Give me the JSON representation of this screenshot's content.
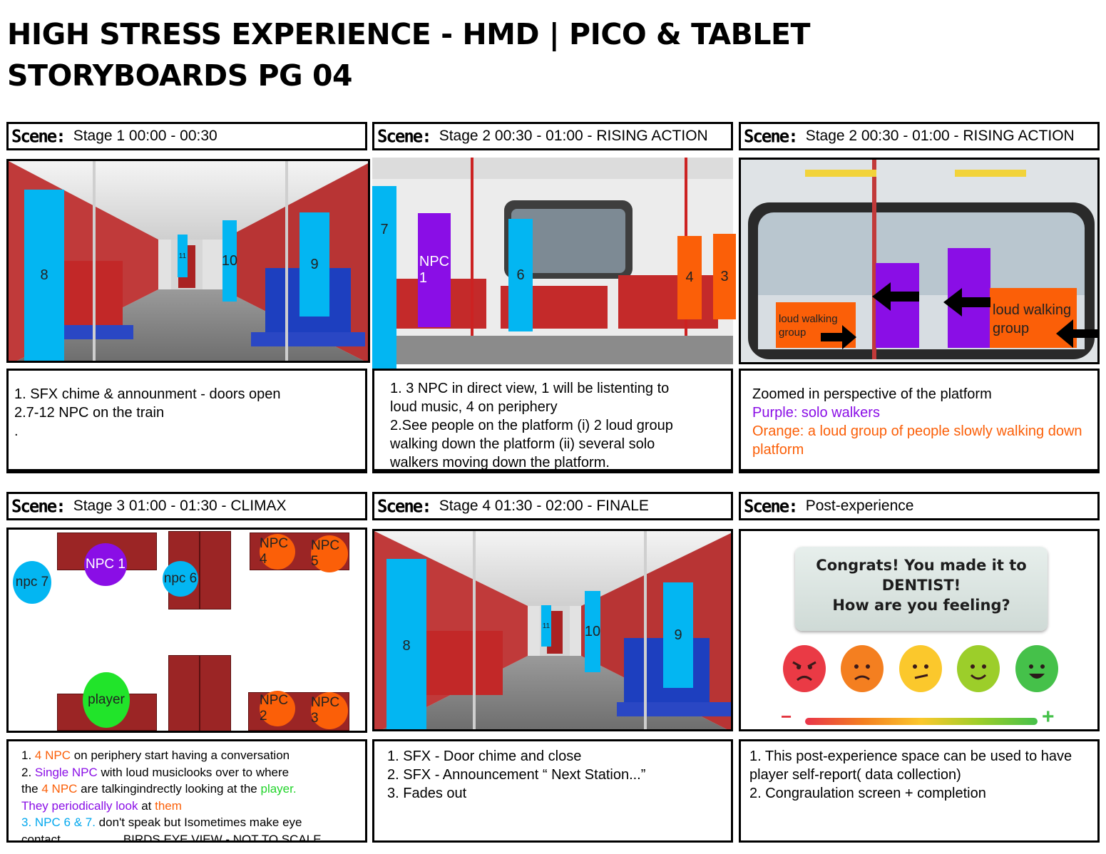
{
  "title": {
    "line1": "HIGH STRESS EXPERIENCE -  HMD | PICO & TABLET",
    "line2": "STORYBOARDS  PG 04"
  },
  "scene_label": "Scene:",
  "scenes": [
    {
      "header": "Stage 1  00:00 - 00:30",
      "blocks": {
        "b8": "8",
        "b11": "11",
        "b10": "10",
        "b9": "9"
      },
      "desc": [
        "1. SFX chime & announment  - doors open",
        "2.7-12  NPC on the train",
        "."
      ]
    },
    {
      "header": "Stage 2  00:30 - 01:00 - RISING ACTION",
      "blocks": {
        "b7": "7",
        "npc1": "NPC 1",
        "b6": "6",
        "b4": "4",
        "b3": "3"
      },
      "desc": [
        "1.  3 NPC in direct view, 1 will be listenting to",
        "loud music,  4 on periphery",
        "2.See people on the platform (i) 2 loud group",
        "walking down the platform (ii) several solo",
        "walkers moving down the platform."
      ]
    },
    {
      "header": "Stage 2  00:30 - 01:00 - RISING ACTION",
      "blocks": {
        "group_left": "loud walking group",
        "group_right": "loud walking group"
      },
      "desc": {
        "line1": "Zoomed in perspective of the platform",
        "purple": "Purple: solo walkers",
        "orange": "Orange: a loud group of people slowly walking  down platform"
      }
    },
    {
      "header": "Stage 3  01:00 - 01:30 - CLIMAX",
      "circles": {
        "npc1": "NPC 1",
        "npc4": "NPC 4",
        "npc5": "NPC 5",
        "npc7": "npc 7",
        "npc6": "npc 6",
        "player": "player",
        "npc2": "NPC 2",
        "npc3": "NPC 3"
      },
      "desc": {
        "l1_num": "1. ",
        "l1_hl": "4 NPC",
        "l1_rest": " on periphery start having a conversation",
        "l2_num": "2. ",
        "l2_hl": "Single NPC",
        "l2_rest": " with loud musiclooks over to where",
        "l3_a": "the ",
        "l3_hl": "4 NPC",
        "l3_b": " are talkingindrectly looking at the ",
        "l3_player": "player.",
        "l4_purple": "They periodically look",
        "l4_at": " at ",
        "l4_them": "them",
        "l5_hl": "3. NPC 6 & 7.",
        "l5_rest": " don't speak but Isometimes make eye",
        "l6": "contact",
        "birds_eye": "BIRDS EYE VIEW - NOT TO SCALE"
      }
    },
    {
      "header": "Stage 4  01:30 - 02:00 - FINALE",
      "blocks": {
        "b8": "8",
        "b11": "11",
        "b10": "10",
        "b9": "9"
      },
      "desc": [
        "1. SFX - Door chime and close",
        "2. SFX - Announcement “ Next Station...”",
        "3. Fades out"
      ]
    },
    {
      "header": "Post-experience",
      "congrats": [
        "Congrats! You made it to",
        "DENTIST!",
        "How are you feeling?"
      ],
      "scale": {
        "minus": "−",
        "plus": "+"
      },
      "faces": [
        "angry",
        "sad",
        "meh",
        "smile",
        "happy"
      ],
      "desc": [
        "1. This post-experience space can be used to have",
        "player self-report( data collection)",
        "2. Congraulation screen + completion"
      ]
    }
  ],
  "colors": {
    "cyan": "#03b6f2",
    "purple": "#8a0ee6",
    "orange": "#fb5f08",
    "green": "#21e42a",
    "seat_red": "#9b2525"
  }
}
